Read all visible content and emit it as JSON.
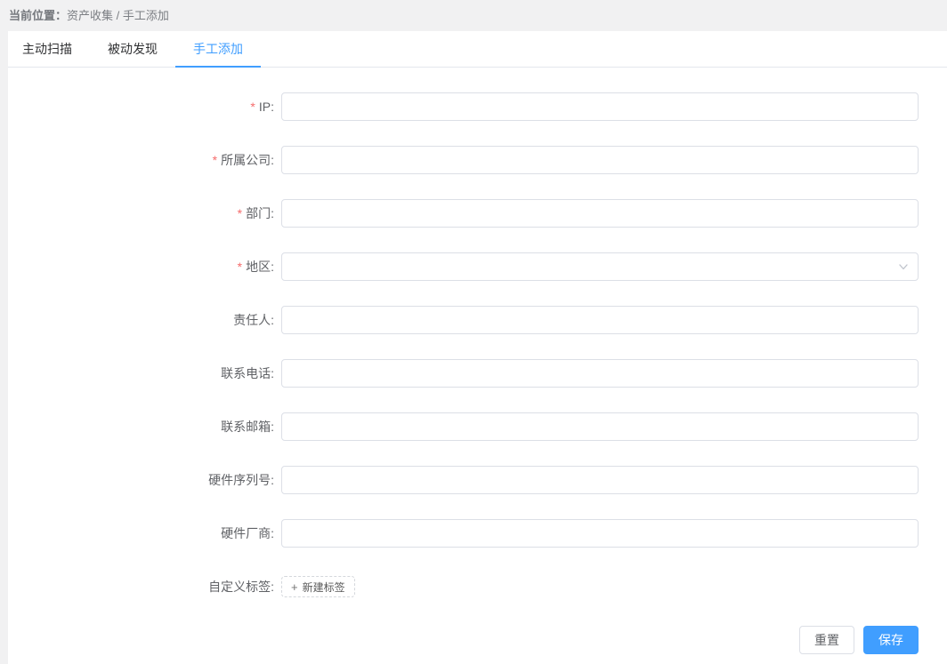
{
  "colors": {
    "accent": "#409eff",
    "required_asterisk": "#f56c6c",
    "input_border": "#dcdfe6",
    "page_background": "#f1f1f2",
    "label_text": "#606266"
  },
  "breadcrumb": {
    "prefix": "当前位置：",
    "path": "资产收集 / 手工添加"
  },
  "tabs": {
    "items": [
      {
        "label": "主动扫描",
        "active": false
      },
      {
        "label": "被动发现",
        "active": false
      },
      {
        "label": "手工添加",
        "active": true
      }
    ]
  },
  "form": {
    "fields": [
      {
        "label": "IP:",
        "required_mark": "*",
        "type": "text",
        "value": ""
      },
      {
        "label": "所属公司:",
        "required_mark": "*",
        "type": "text",
        "value": ""
      },
      {
        "label": "部门:",
        "required_mark": "*",
        "type": "text",
        "value": ""
      },
      {
        "label": "地区:",
        "required_mark": "*",
        "type": "select",
        "value": ""
      },
      {
        "label": "责任人:",
        "type": "text",
        "value": ""
      },
      {
        "label": "联系电话:",
        "type": "text",
        "value": ""
      },
      {
        "label": "联系邮箱:",
        "type": "text",
        "value": ""
      },
      {
        "label": "硬件序列号:",
        "type": "text",
        "value": ""
      },
      {
        "label": "硬件厂商:",
        "type": "text",
        "value": ""
      }
    ],
    "tag_row": {
      "label": "自定义标签:",
      "button": {
        "icon": "+",
        "label": "新建标签"
      }
    }
  },
  "footer": {
    "reset_label": "重置",
    "save_label": "保存"
  }
}
